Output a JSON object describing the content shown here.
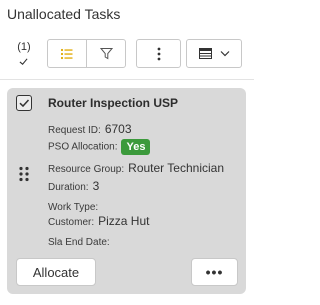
{
  "header": {
    "title": "Unallocated Tasks"
  },
  "toolbar": {
    "selected_count": "(1)",
    "list_icon": "list-icon",
    "filter_icon": "filter-icon",
    "more_icon": "vertical-dots-icon",
    "view_icon": "table-view-icon",
    "chevron_icon": "chevron-down-icon"
  },
  "task": {
    "title": "Router Inspection USP",
    "selected": true,
    "fields": {
      "request_id": {
        "label": "Request ID:",
        "value": "6703"
      },
      "pso_allocation": {
        "label": "PSO Allocation:",
        "value": "Yes"
      },
      "resource_group": {
        "label": "Resource Group:",
        "value": "Router Technician"
      },
      "duration": {
        "label": "Duration:",
        "value": "3"
      },
      "work_type": {
        "label": "Work Type:",
        "value": ""
      },
      "customer": {
        "label": "Customer:",
        "value": "Pizza Hut"
      },
      "sla_end_date": {
        "label": "Sla End Date:",
        "value": ""
      }
    },
    "allocate_label": "Allocate",
    "more_label": "•••"
  },
  "colors": {
    "card_bg": "#d9d9d9",
    "badge_green": "#3c9a3c",
    "accent_yellow": "#e0a800"
  }
}
